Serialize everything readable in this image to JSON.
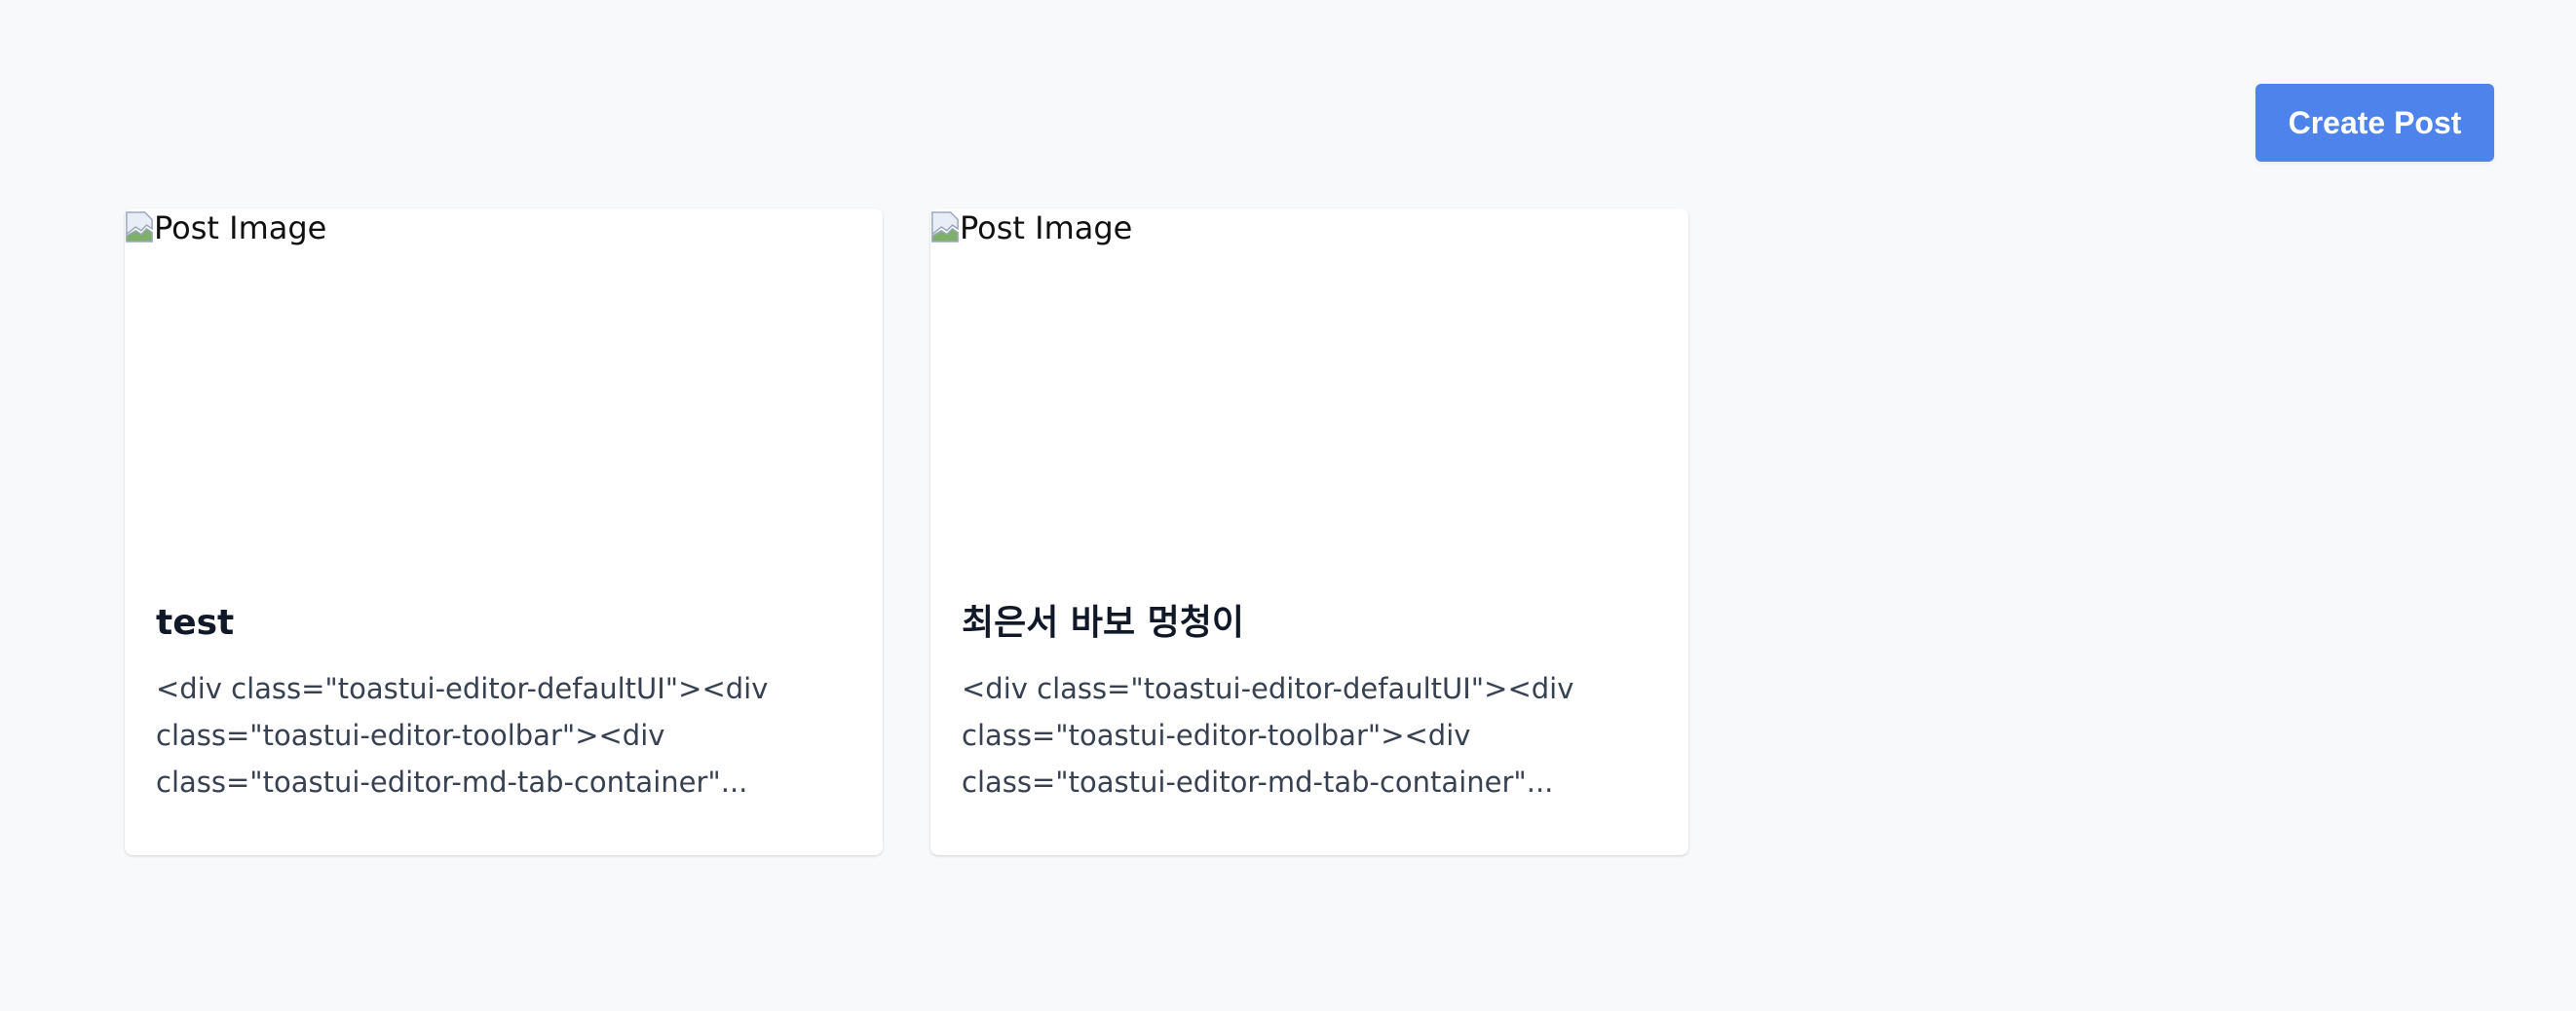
{
  "header": {
    "create_button_label": "Create Post"
  },
  "posts": [
    {
      "image_alt": "Post Image",
      "title": "test",
      "excerpt_lines": [
        "<div class=\"toastui-editor-defaultUI\"><div",
        "class=\"toastui-editor-toolbar\"><div",
        "class=\"toastui-editor-md-tab-container\"..."
      ]
    },
    {
      "image_alt": "Post Image",
      "title": "최은서 바보 멍청이",
      "excerpt_lines": [
        "<div class=\"toastui-editor-defaultUI\"><div",
        "class=\"toastui-editor-toolbar\"><div",
        "class=\"toastui-editor-md-tab-container\"..."
      ]
    }
  ]
}
